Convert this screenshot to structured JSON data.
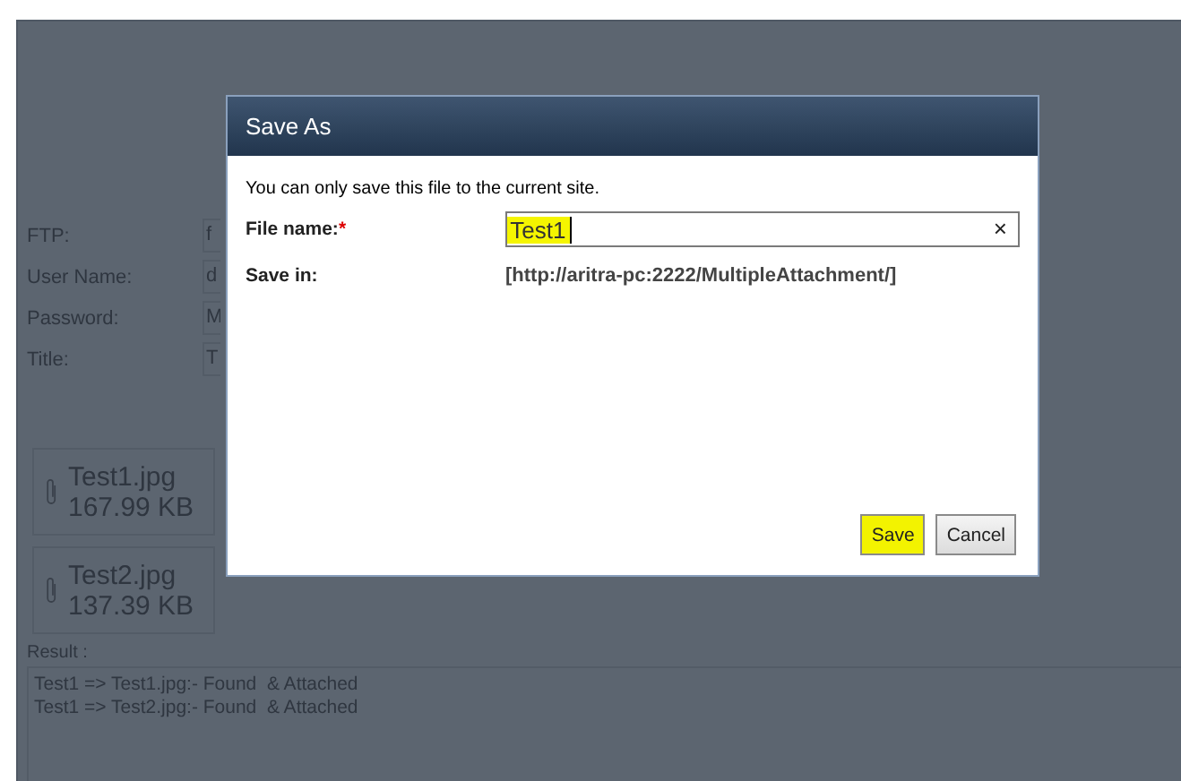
{
  "form": {
    "fields": [
      {
        "label": "FTP:",
        "value": "f"
      },
      {
        "label": "User Name:",
        "value": "d"
      },
      {
        "label": "Password:",
        "value": "M"
      },
      {
        "label": "Title:",
        "value": "T"
      }
    ]
  },
  "attachments": [
    {
      "name": "Test1.jpg",
      "size": "167.99 KB"
    },
    {
      "name": "Test2.jpg",
      "size": "137.39 KB"
    }
  ],
  "result": {
    "label": "Result :",
    "lines": [
      "Test1 => Test1.jpg:- Found  & Attached",
      "Test1 => Test2.jpg:- Found  & Attached"
    ]
  },
  "dialog": {
    "title": "Save As",
    "message": "You can only save this file to the current site.",
    "file_name": {
      "label": "File name:",
      "required_mark": "*",
      "value": "Test1",
      "highlighted": true,
      "clear": "×"
    },
    "save_in": {
      "label": "Save in:",
      "value": "[http://aritra-pc:2222/MultipleAttachment/]"
    },
    "buttons": [
      {
        "label": "Save",
        "highlighted": true
      },
      {
        "label": "Cancel",
        "highlighted": false
      }
    ]
  }
}
